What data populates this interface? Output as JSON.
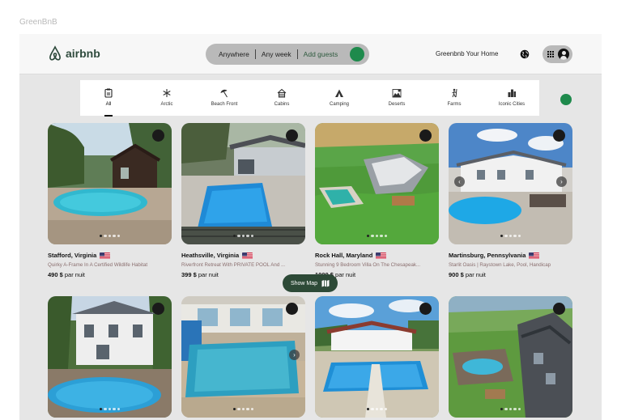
{
  "canvas_label": "GreenBnB",
  "header": {
    "brand": "airbnb",
    "search": {
      "anywhere": "Anywhere",
      "any_week": "Any week",
      "add_guests": "Add guests"
    },
    "host_link": "Greenbnb Your Home",
    "icons": [
      "globe-icon",
      "menu-icon",
      "avatar"
    ]
  },
  "colors": {
    "accent": "#1e8a4c",
    "brand": "#2e4a3c",
    "map_button": "#2d4a37"
  },
  "categories": [
    {
      "label": "All",
      "icon": "listing-icon",
      "active": true
    },
    {
      "label": "Arctic",
      "icon": "snowflake-icon",
      "active": false
    },
    {
      "label": "Beach Front",
      "icon": "umbrella-icon",
      "active": false
    },
    {
      "label": "Cabins",
      "icon": "cabin-icon",
      "active": false
    },
    {
      "label": "Camping",
      "icon": "tent-icon",
      "active": false
    },
    {
      "label": "Deserts",
      "icon": "desert-icon",
      "active": false
    },
    {
      "label": "Farms",
      "icon": "farmer-icon",
      "active": false
    },
    {
      "label": "Iconic Cities",
      "icon": "city-icon",
      "active": false
    }
  ],
  "listings": [
    {
      "location": "Stafford, Virginia",
      "description": "Quirky A-Frame In A Certified Wildlife Habitat",
      "price": "490 $",
      "per": "par nuit"
    },
    {
      "location": "Heathsville, Virginia",
      "description": "Riverfront Retreat With PRIVATE POOL And ...",
      "price": "399 $",
      "per": "par nuit"
    },
    {
      "location": "Rock Hall, Maryland",
      "description": "Stunning 9 Bedroom Villa On The Chesapeak...",
      "price": "1000 $",
      "per": "par nuit"
    },
    {
      "location": "Martinsburg, Pennsylvania",
      "description": "Starlit Oasis | Raystown Lake, Pool, Handicap",
      "price": "900 $",
      "per": "par nuit"
    }
  ],
  "show_map": {
    "label": "Show Map",
    "icon": "map-icon"
  }
}
